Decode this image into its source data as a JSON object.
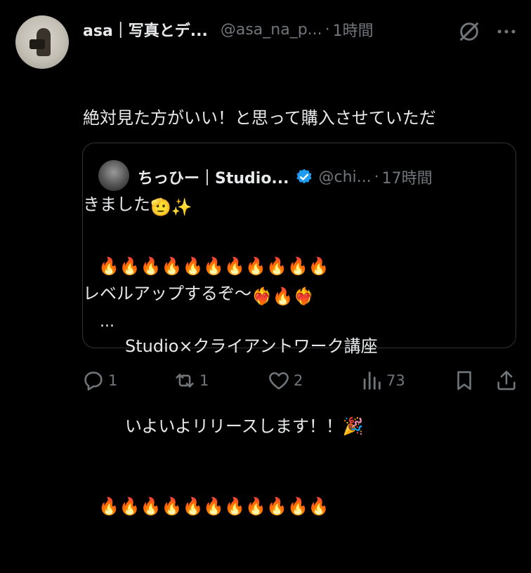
{
  "tweet": {
    "display_name": "asa｜写真とデ...",
    "handle": "@asa_na_p...",
    "separator": "·",
    "time": "1時間",
    "text_line1": "絶対見た方がいい！と思って購入させていただ",
    "text_line2_prefix": "きました",
    "text_line3_prefix": "レベルアップするぞ〜",
    "emoji_salute": "🫡",
    "emoji_sparkles": "✨",
    "emoji_fire": "🔥",
    "emoji_heart_fire": "❤️‍🔥"
  },
  "quoted": {
    "display_name": "ちっひー｜Studio...",
    "handle": "@chi...",
    "separator": "·",
    "time": "17時間",
    "fire_row": "🔥🔥🔥🔥🔥🔥🔥🔥🔥🔥🔥",
    "line1": "Studio×クライアントワーク講座",
    "line2": "いよいよリリースします！！🎉",
    "ellipsis": "..."
  },
  "actions": {
    "replies": "1",
    "reposts": "1",
    "likes": "2",
    "views": "73"
  },
  "colors": {
    "background": "#000000",
    "text": "#e7e9ea",
    "muted": "#71767b",
    "verified": "#1d9bf0",
    "border": "#2f3336"
  }
}
